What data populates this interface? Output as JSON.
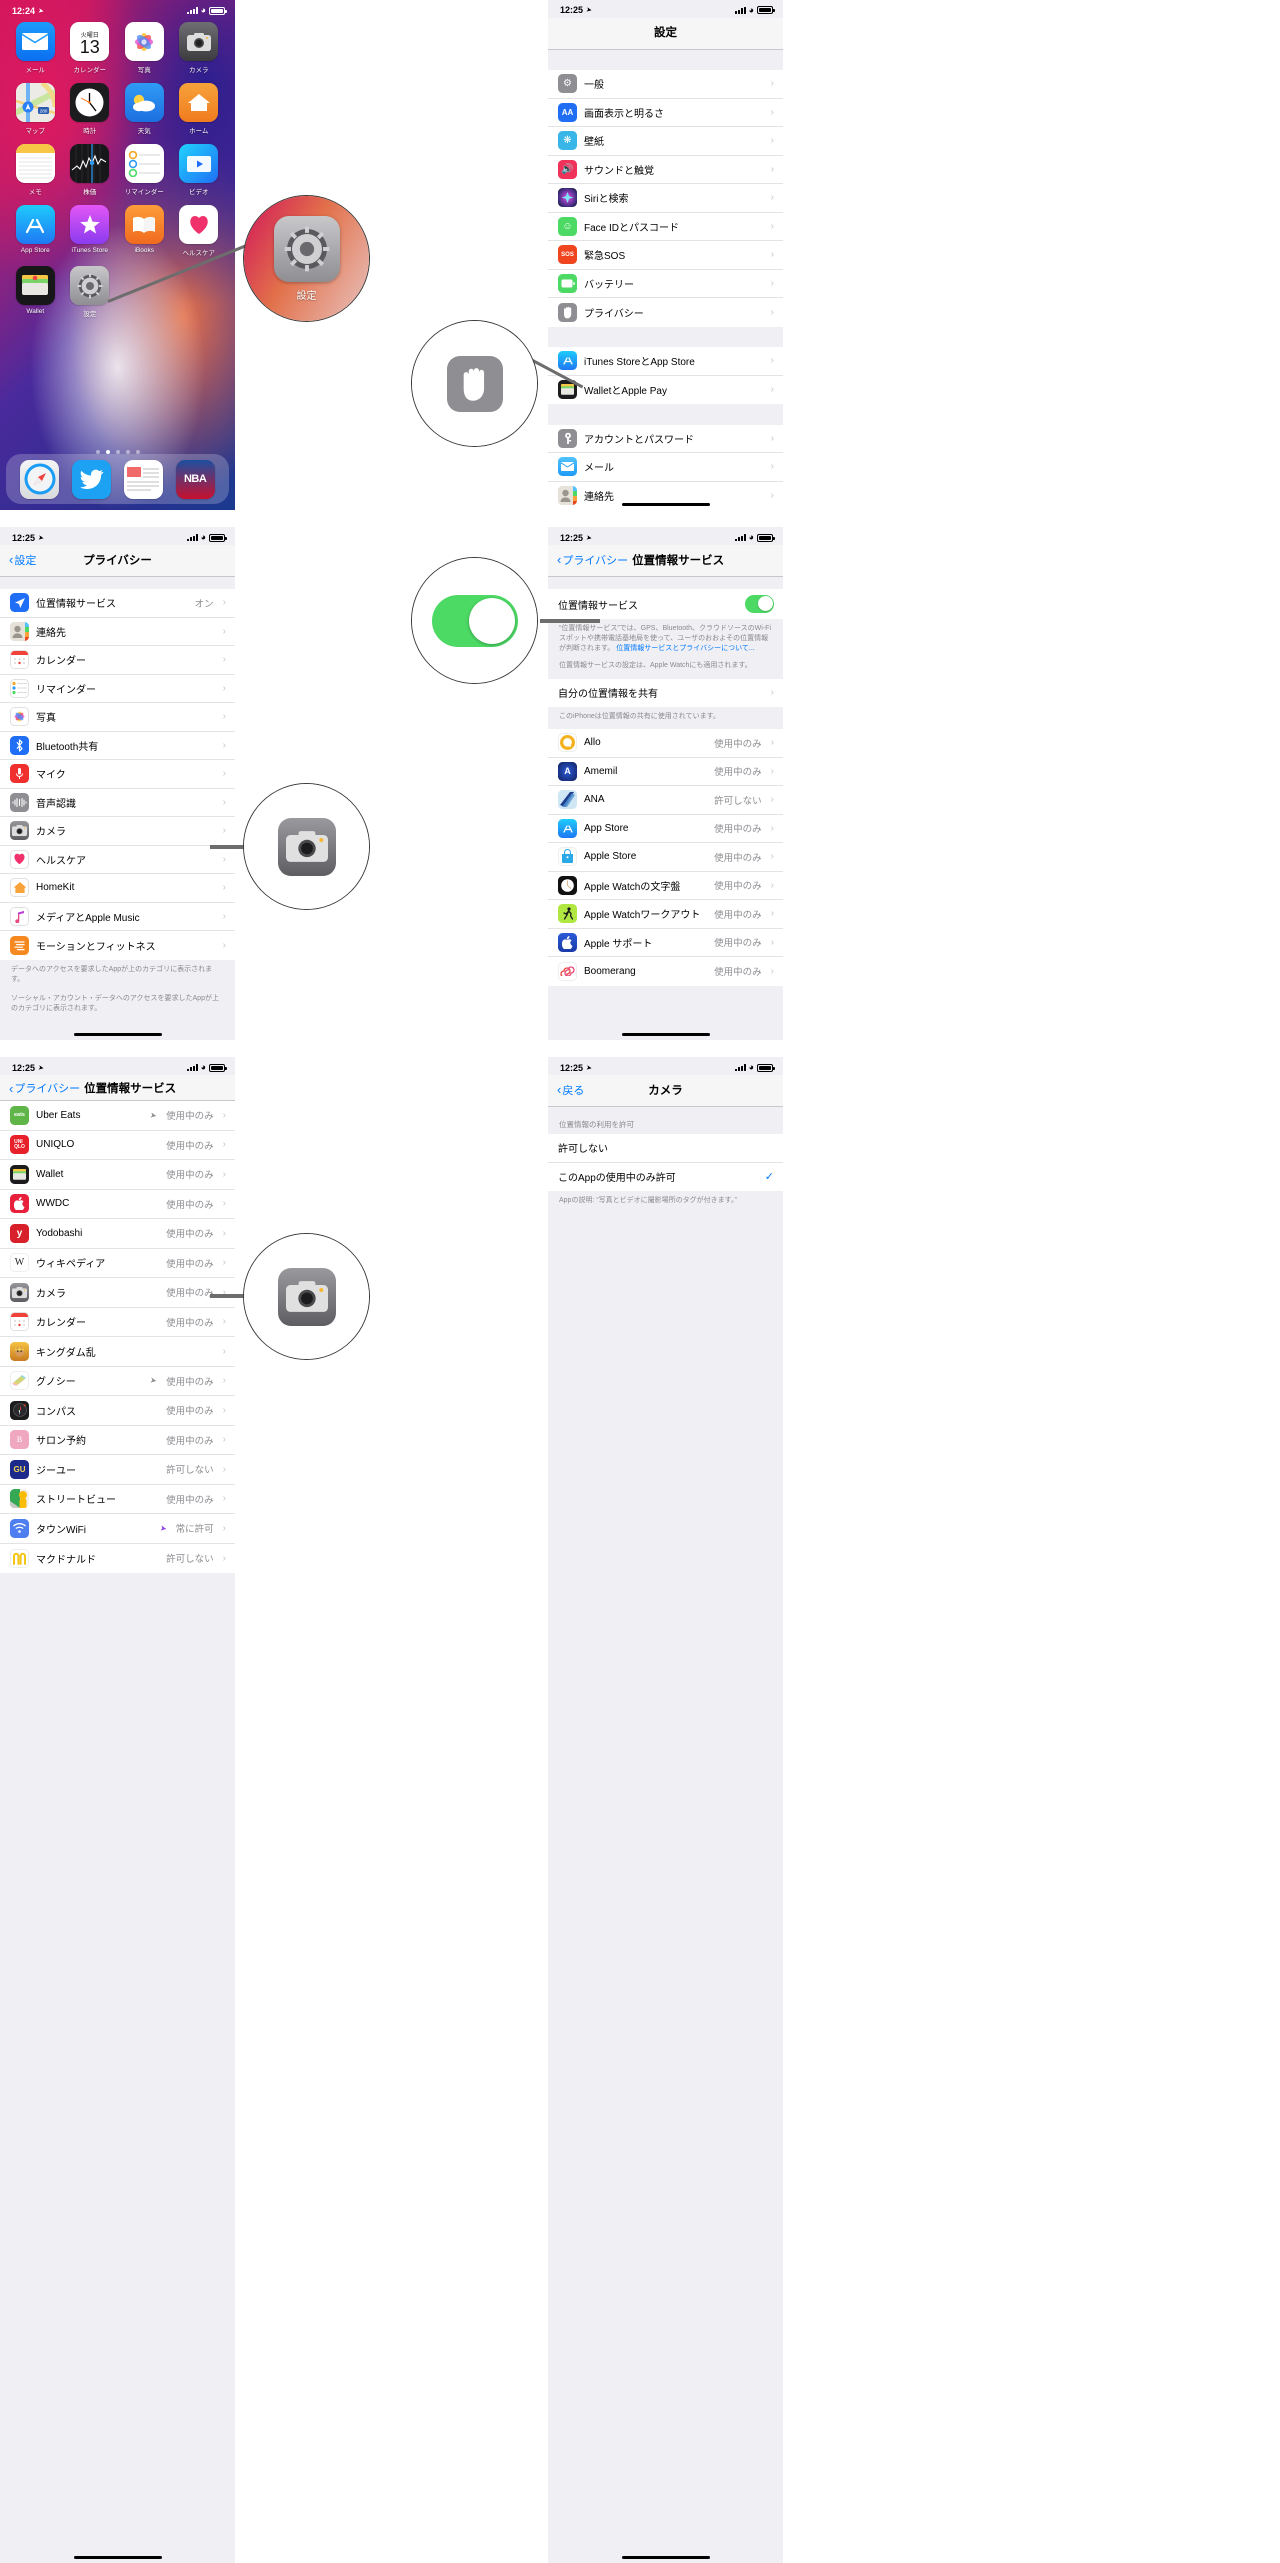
{
  "home": {
    "status": {
      "time": "12:24"
    },
    "rows": [
      [
        {
          "label": "メール",
          "icon": "mail-icon"
        },
        {
          "label": "カレンダー",
          "icon": "calendar-icon",
          "day": "火曜日",
          "date": "13"
        },
        {
          "label": "写真",
          "icon": "photos-icon"
        },
        {
          "label": "カメラ",
          "icon": "camera-icon"
        }
      ],
      [
        {
          "label": "マップ",
          "icon": "maps-icon"
        },
        {
          "label": "時計",
          "icon": "clock-icon"
        },
        {
          "label": "天気",
          "icon": "weather-icon"
        },
        {
          "label": "ホーム",
          "icon": "home-icon"
        }
      ],
      [
        {
          "label": "メモ",
          "icon": "notes-icon"
        },
        {
          "label": "株価",
          "icon": "stocks-icon"
        },
        {
          "label": "リマインダー",
          "icon": "reminders-icon"
        },
        {
          "label": "ビデオ",
          "icon": "videos-icon"
        }
      ],
      [
        {
          "label": "App Store",
          "icon": "appstore-icon"
        },
        {
          "label": "iTunes Store",
          "icon": "itunes-icon"
        },
        {
          "label": "iBooks",
          "icon": "ibooks-icon"
        },
        {
          "label": "ヘルスケア",
          "icon": "health-icon"
        }
      ],
      [
        {
          "label": "Wallet",
          "icon": "wallet-icon"
        },
        {
          "label": "設定",
          "icon": "settings-icon"
        }
      ]
    ],
    "dock": [
      "safari-icon",
      "twitter-icon",
      "news-icon",
      "nba-icon"
    ],
    "page_dots": 5,
    "active_dot": 2
  },
  "settings": {
    "status": {
      "time": "12:25"
    },
    "title": "設定",
    "group1": [
      {
        "label": "一般",
        "icon": "gear-icon"
      },
      {
        "label": "画面表示と明るさ",
        "icon": "display-icon"
      },
      {
        "label": "壁紙",
        "icon": "wallpaper-icon"
      },
      {
        "label": "サウンドと触覚",
        "icon": "sound-icon"
      },
      {
        "label": "Siriと検索",
        "icon": "siri-icon"
      },
      {
        "label": "Face IDとパスコード",
        "icon": "faceid-icon"
      },
      {
        "label": "緊急SOS",
        "icon": "sos-icon"
      },
      {
        "label": "バッテリー",
        "icon": "battery-icon"
      },
      {
        "label": "プライバシー",
        "icon": "privacy-hand-icon"
      }
    ],
    "group2": [
      {
        "label": "iTunes StoreとApp Store",
        "icon": "appstore-icon"
      },
      {
        "label": "WalletとApple Pay",
        "icon": "wallet-icon"
      }
    ],
    "group3": [
      {
        "label": "アカウントとパスワード",
        "icon": "key-icon"
      },
      {
        "label": "メール",
        "icon": "mail-icon"
      },
      {
        "label": "連絡先",
        "icon": "contacts-icon"
      }
    ]
  },
  "privacy": {
    "status": {
      "time": "12:25"
    },
    "back_label": "設定",
    "title": "プライバシー",
    "items": [
      {
        "label": "位置情報サービス",
        "value": "オン",
        "icon": "location-icon"
      },
      {
        "label": "連絡先",
        "value": "",
        "icon": "contacts-icon"
      },
      {
        "label": "カレンダー",
        "value": "",
        "icon": "calendar-icon"
      },
      {
        "label": "リマインダー",
        "value": "",
        "icon": "reminders-icon"
      },
      {
        "label": "写真",
        "value": "",
        "icon": "photos-icon"
      },
      {
        "label": "Bluetooth共有",
        "value": "",
        "icon": "bluetooth-icon"
      },
      {
        "label": "マイク",
        "value": "",
        "icon": "mic-icon"
      },
      {
        "label": "音声認識",
        "value": "",
        "icon": "speech-icon"
      },
      {
        "label": "カメラ",
        "value": "",
        "icon": "camera-icon"
      },
      {
        "label": "ヘルスケア",
        "value": "",
        "icon": "health-icon"
      },
      {
        "label": "HomeKit",
        "value": "",
        "icon": "homekit-icon"
      },
      {
        "label": "メディアとApple Music",
        "value": "",
        "icon": "music-icon"
      },
      {
        "label": "モーションとフィットネス",
        "value": "",
        "icon": "motion-icon"
      }
    ],
    "footer1": "データへのアクセスを要求したAppが上のカテゴリに表示されます。",
    "footer2": "ソーシャル・アカウント・データへのアクセスを要求したAppが上のカテゴリに表示されます。"
  },
  "location": {
    "status": {
      "time": "12:25"
    },
    "back_label": "プライバシー",
    "title": "位置情報サービス",
    "toggle_label": "位置情報サービス",
    "toggle_on": true,
    "description_a": "“位置情報サービス”では、GPS、Bluetooth、クラウドソースのWi-Fiスポットや携帯電話基地局を使って、ユーザのおおよその位置情報が判断されます。",
    "description_link": "位置情報サービスとプライバシーについて...",
    "description_b": "位置情報サービスの設定は、Apple Watchにも適用されます。",
    "share_row": "自分の位置情報を共有",
    "share_note": "このiPhoneは位置情報の共有に使用されています。",
    "apps": [
      {
        "name": "Allo",
        "value": "使用中のみ",
        "icon": "allo-icon"
      },
      {
        "name": "Amemil",
        "value": "使用中のみ",
        "icon": "amemil-icon"
      },
      {
        "name": "ANA",
        "value": "許可しない",
        "icon": "ana-icon"
      },
      {
        "name": "App Store",
        "value": "使用中のみ",
        "icon": "appstore-icon"
      },
      {
        "name": "Apple Store",
        "value": "使用中のみ",
        "icon": "applestore-icon"
      },
      {
        "name": "Apple Watchの文字盤",
        "value": "使用中のみ",
        "icon": "watchface-icon"
      },
      {
        "name": "Apple Watchワークアウト",
        "value": "使用中のみ",
        "icon": "workout-icon"
      },
      {
        "name": "Apple サポート",
        "value": "使用中のみ",
        "icon": "applesupport-icon"
      },
      {
        "name": "Boomerang",
        "value": "使用中のみ",
        "icon": "boomerang-icon"
      }
    ]
  },
  "location2": {
    "status": {
      "time": "12:25"
    },
    "back_label": "プライバシー",
    "title": "位置情報サービス",
    "apps": [
      {
        "name": "Uber Eats",
        "value": "使用中のみ",
        "arrow": true,
        "icon": "ubereats-icon"
      },
      {
        "name": "UNIQLO",
        "value": "使用中のみ",
        "arrow": false,
        "icon": "uniqlo-icon"
      },
      {
        "name": "Wallet",
        "value": "使用中のみ",
        "arrow": false,
        "icon": "wallet-icon"
      },
      {
        "name": "WWDC",
        "value": "使用中のみ",
        "arrow": false,
        "icon": "wwdc-icon"
      },
      {
        "name": "Yodobashi",
        "value": "使用中のみ",
        "arrow": false,
        "icon": "yodobashi-icon"
      },
      {
        "name": "ウィキペディア",
        "value": "使用中のみ",
        "arrow": false,
        "icon": "wikipedia-icon"
      },
      {
        "name": "カメラ",
        "value": "使用中のみ",
        "arrow": false,
        "icon": "camera-icon"
      },
      {
        "name": "カレンダー",
        "value": "使用中のみ",
        "arrow": false,
        "icon": "calendar-icon"
      },
      {
        "name": "キングダム乱",
        "value": "",
        "arrow": false,
        "icon": "kingdom-icon"
      },
      {
        "name": "グノシー",
        "value": "使用中のみ",
        "arrow": true,
        "icon": "gunosy-icon"
      },
      {
        "name": "コンパス",
        "value": "使用中のみ",
        "arrow": false,
        "icon": "compass-icon"
      },
      {
        "name": "サロン予約",
        "value": "使用中のみ",
        "arrow": false,
        "icon": "salon-icon"
      },
      {
        "name": "ジーユー",
        "value": "許可しない",
        "arrow": false,
        "icon": "gu-icon"
      },
      {
        "name": "ストリートビュー",
        "value": "使用中のみ",
        "arrow": false,
        "icon": "streetview-icon"
      },
      {
        "name": "タウンWiFi",
        "value": "常に許可",
        "arrow": true,
        "arrow_purple": true,
        "icon": "townwifi-icon"
      },
      {
        "name": "マクドナルド",
        "value": "許可しない",
        "arrow": false,
        "icon": "mcdonalds-icon"
      }
    ]
  },
  "camera_perm": {
    "status": {
      "time": "12:25"
    },
    "back_label": "戻る",
    "title": "カメラ",
    "section_header": "位置情報の利用を許可",
    "options": [
      {
        "label": "許可しない",
        "checked": false
      },
      {
        "label": "このAppの使用中のみ許可",
        "checked": true
      }
    ],
    "footer": "Appの説明: “写真とビデオに撮影場所のタグが付きます。”"
  },
  "callouts": [
    {
      "id": "settings-app-callout",
      "icon": "settings-icon",
      "label": "設定"
    },
    {
      "id": "privacy-hand-callout",
      "icon": "privacy-hand-icon",
      "label": ""
    },
    {
      "id": "location-toggle-callout",
      "icon": "toggle-on-icon",
      "label": ""
    },
    {
      "id": "camera-privacy-callout",
      "icon": "camera-icon",
      "label": ""
    },
    {
      "id": "camera-location-callout",
      "icon": "camera-icon",
      "label": ""
    }
  ],
  "colors": {
    "accent_blue": "#007aff",
    "toggle_green": "#4cd964",
    "gray_text": "#8e8e93",
    "list_bg": "#efeff4"
  }
}
